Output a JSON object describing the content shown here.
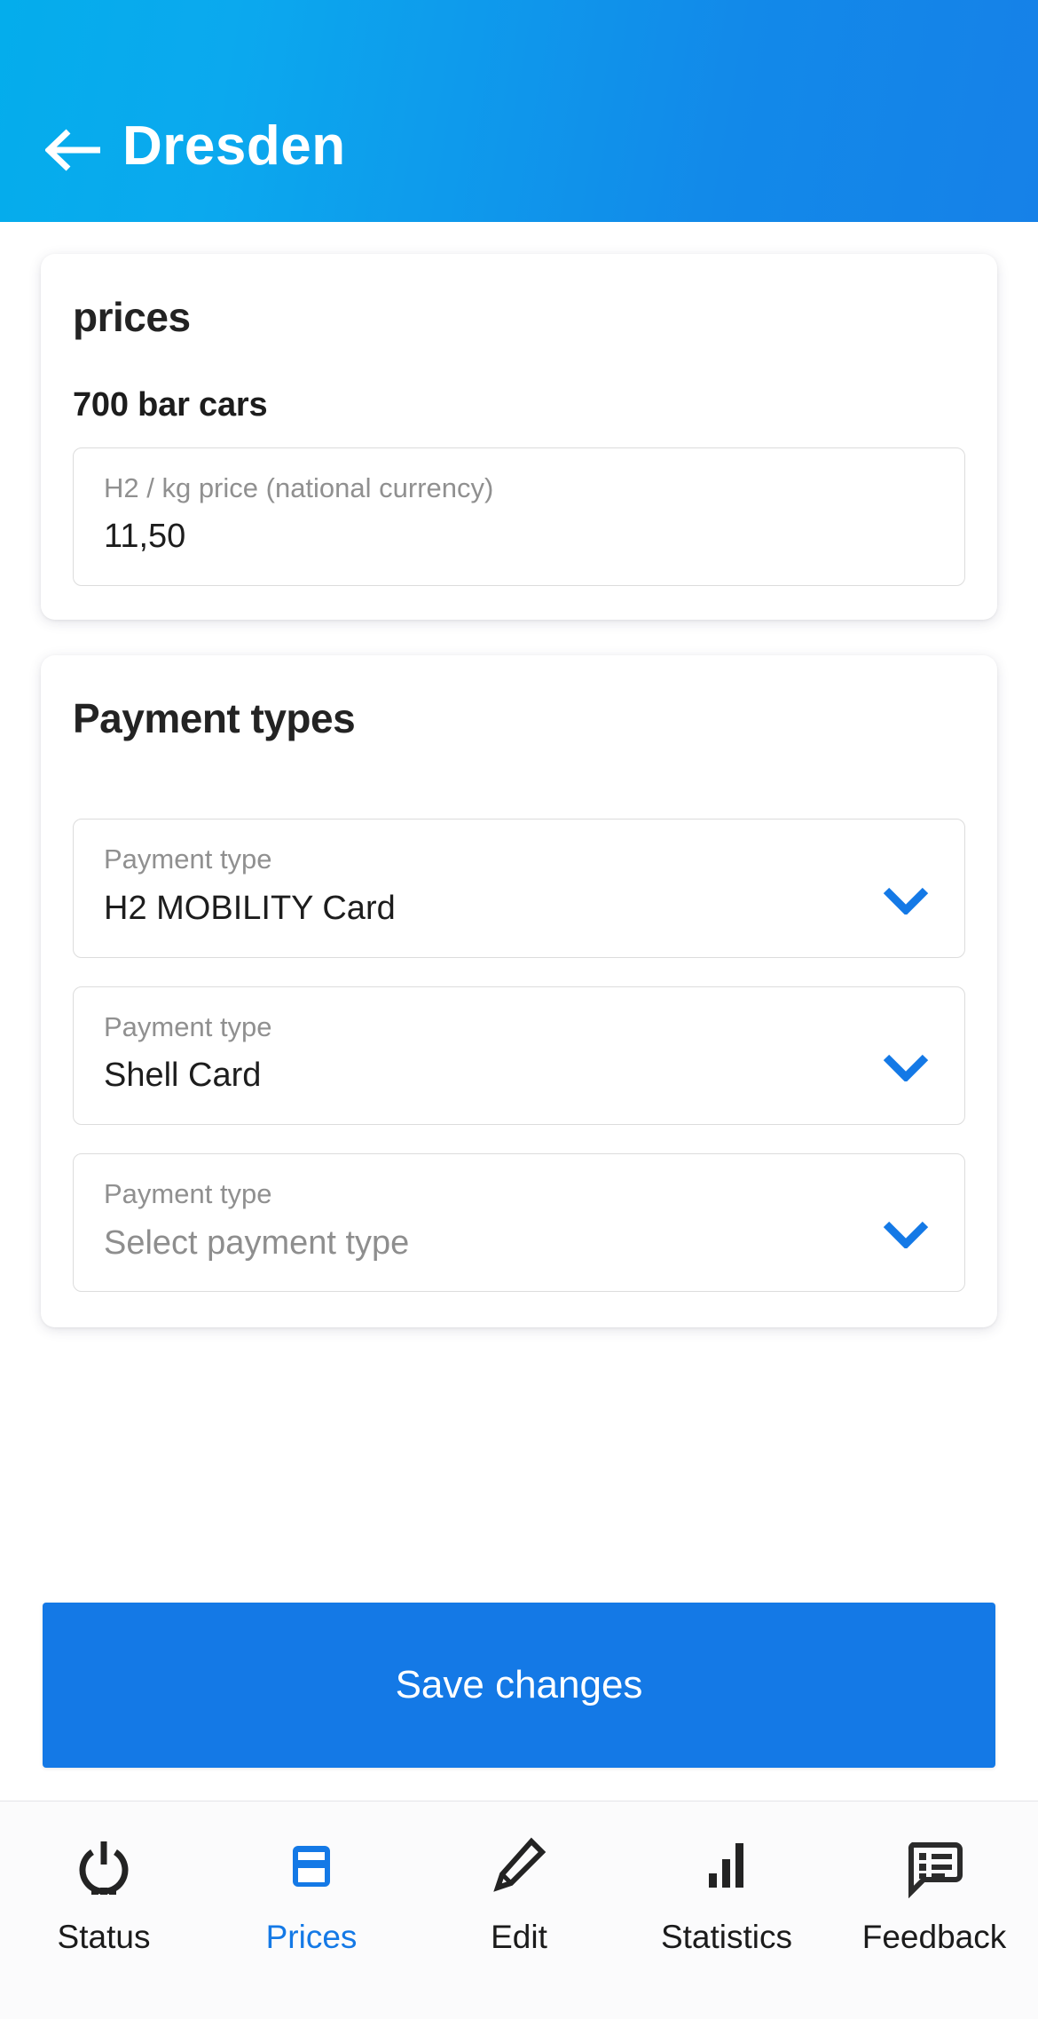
{
  "header": {
    "title": "Dresden",
    "back_icon": "arrow-left-icon"
  },
  "prices_card": {
    "title": "prices",
    "subsection_title": "700 bar cars",
    "price_field": {
      "label": "H2 / kg price (national currency)",
      "value": "11,50"
    }
  },
  "payment_card": {
    "title": "Payment types",
    "rows": [
      {
        "label": "Payment type",
        "value": "H2 MOBILITY Card",
        "is_placeholder": false
      },
      {
        "label": "Payment type",
        "value": "Shell Card",
        "is_placeholder": false
      },
      {
        "label": "Payment type",
        "value": "Select payment type",
        "is_placeholder": true
      }
    ]
  },
  "save_button": {
    "label": "Save changes"
  },
  "bottom_nav": {
    "items": [
      {
        "label": "Status",
        "icon": "power-icon",
        "active": false
      },
      {
        "label": "Prices",
        "icon": "card-icon",
        "active": true
      },
      {
        "label": "Edit",
        "icon": "pencil-icon",
        "active": false
      },
      {
        "label": "Statistics",
        "icon": "bar-chart-icon",
        "active": false
      },
      {
        "label": "Feedback",
        "icon": "chat-list-icon",
        "active": false
      }
    ]
  },
  "colors": {
    "header_gradient_start": "#04ADEC",
    "header_gradient_end": "#1681E8",
    "accent": "#1479E6",
    "text_primary": "#1d1d1d",
    "text_muted": "#909090"
  }
}
